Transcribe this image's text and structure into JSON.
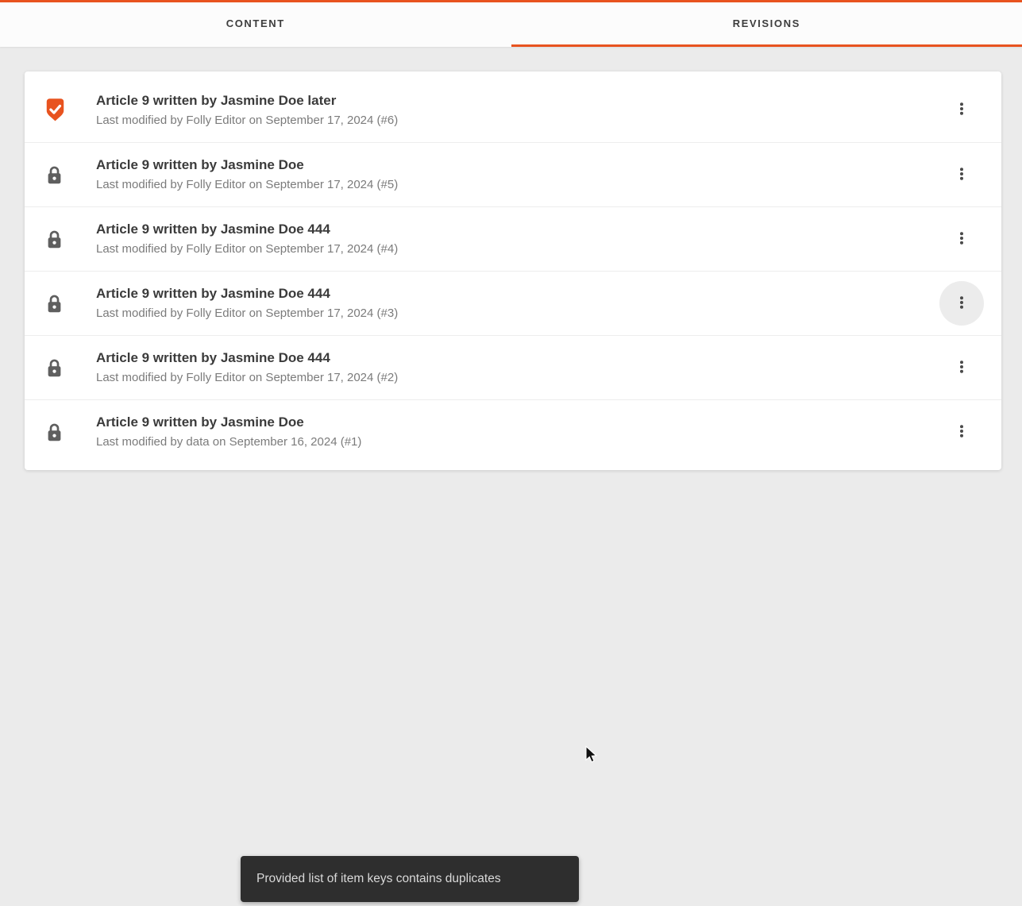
{
  "tabs": [
    {
      "label": "CONTENT",
      "active": false
    },
    {
      "label": "REVISIONS",
      "active": true
    }
  ],
  "colors": {
    "accent": "#e8531f",
    "toast_background": "#2e2e2e",
    "page_background": "#ebebeb"
  },
  "icons": {
    "current_revision": "verified-shield-check-icon",
    "locked_revision": "lock-icon",
    "row_menu": "kebab-menu-icon",
    "pointer": "mouse-cursor"
  },
  "revisions": [
    {
      "icon": "verified-shield-check",
      "title": "Article 9 written by Jasmine Doe later",
      "subtitle": "Last modified by Folly Editor on September 17, 2024 (#6)",
      "menu_hover": false
    },
    {
      "icon": "lock",
      "title": "Article 9 written by Jasmine Doe",
      "subtitle": "Last modified by Folly Editor on September 17, 2024 (#5)",
      "menu_hover": false
    },
    {
      "icon": "lock",
      "title": "Article 9 written by Jasmine Doe 444",
      "subtitle": "Last modified by Folly Editor on September 17, 2024 (#4)",
      "menu_hover": false
    },
    {
      "icon": "lock",
      "title": "Article 9 written by Jasmine Doe 444",
      "subtitle": "Last modified by Folly Editor on September 17, 2024 (#3)",
      "menu_hover": true
    },
    {
      "icon": "lock",
      "title": "Article 9 written by Jasmine Doe 444",
      "subtitle": "Last modified by Folly Editor on September 17, 2024 (#2)",
      "menu_hover": false
    },
    {
      "icon": "lock",
      "title": "Article 9 written by Jasmine Doe",
      "subtitle": "Last modified by data on September 16, 2024 (#1)",
      "menu_hover": false
    }
  ],
  "toast": {
    "message": "Provided list of item keys contains duplicates"
  }
}
